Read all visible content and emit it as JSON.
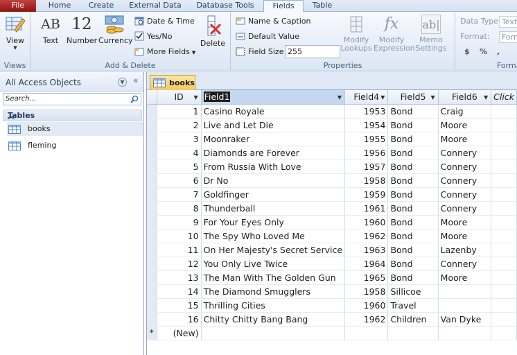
{
  "ribbon_tabs": [
    "File",
    "Home",
    "Create",
    "External Data",
    "Database Tools",
    "Fields",
    "Table"
  ],
  "ribbon": {
    "views": {
      "label": "Views",
      "view_btn": "View"
    },
    "add_delete": {
      "label": "Add & Delete",
      "text_btn": "Text",
      "number_btn": "Number",
      "currency_btn": "Currency",
      "date_time": "Date & Time",
      "yes_no": "Yes/No",
      "more_fields": "More Fields",
      "delete_btn": "Delete"
    },
    "properties": {
      "label": "Properties",
      "name_caption": "Name & Caption",
      "default_value": "Default Value",
      "field_size_label": "Field Size",
      "field_size_value": "255",
      "modify_lookups": "Modify Lookups",
      "modify_expression": "Modify Expression",
      "memo_settings": "Memo Settings"
    },
    "formatting": {
      "label": "Forma",
      "data_type_label": "Data Type:",
      "data_type_value": "Text",
      "format_label": "Format:",
      "format_value": "Form",
      "currency_sym": "$",
      "percent_sym": "%",
      "comma_sym": ","
    },
    "icons": {
      "ab": "AB",
      "twelve": "12",
      "fx": "fx",
      "abl": "ab|"
    }
  },
  "nav": {
    "title": "All Access Objects",
    "search_placeholder": "Search...",
    "section": "Tables",
    "items": [
      "books",
      "fleming"
    ]
  },
  "doc_tab": "books",
  "grid": {
    "columns": [
      "ID",
      "Field1",
      "Field4",
      "Field5",
      "Field6",
      "Click"
    ],
    "rows": [
      [
        "1",
        "Casino Royale",
        "1953",
        "Bond",
        "Craig"
      ],
      [
        "2",
        "Live and Let Die",
        "1954",
        "Bond",
        "Moore"
      ],
      [
        "3",
        "Moonraker",
        "1955",
        "Bond",
        "Moore"
      ],
      [
        "4",
        "Diamonds are Forever",
        "1956",
        "Bond",
        "Connery"
      ],
      [
        "5",
        "From Russia With Love",
        "1957",
        "Bond",
        "Connery"
      ],
      [
        "6",
        "Dr No",
        "1958",
        "Bond",
        "Connery"
      ],
      [
        "7",
        "Goldfinger",
        "1959",
        "Bond",
        "Connery"
      ],
      [
        "8",
        "Thunderball",
        "1961",
        "Bond",
        "Connery"
      ],
      [
        "9",
        "For Your Eyes Only",
        "1960",
        "Bond",
        "Moore"
      ],
      [
        "10",
        "The Spy Who Loved Me",
        "1962",
        "Bond",
        "Moore"
      ],
      [
        "11",
        "On Her Majesty's Secret Service",
        "1963",
        "Bond",
        "Lazenby"
      ],
      [
        "12",
        "You Only Live Twice",
        "1964",
        "Bond",
        "Connery"
      ],
      [
        "13",
        "The Man With The Golden Gun",
        "1965",
        "Bond",
        "Moore"
      ],
      [
        "14",
        "The Diamond Smugglers",
        "1958",
        "Sillicoe",
        ""
      ],
      [
        "15",
        "Thrilling Cities",
        "1960",
        "Travel",
        ""
      ],
      [
        "16",
        "Chitty Chitty Bang Bang",
        "1962",
        "Children",
        "Van Dyke"
      ]
    ],
    "new_row_marker": "*",
    "new_row_label": "(New)"
  }
}
